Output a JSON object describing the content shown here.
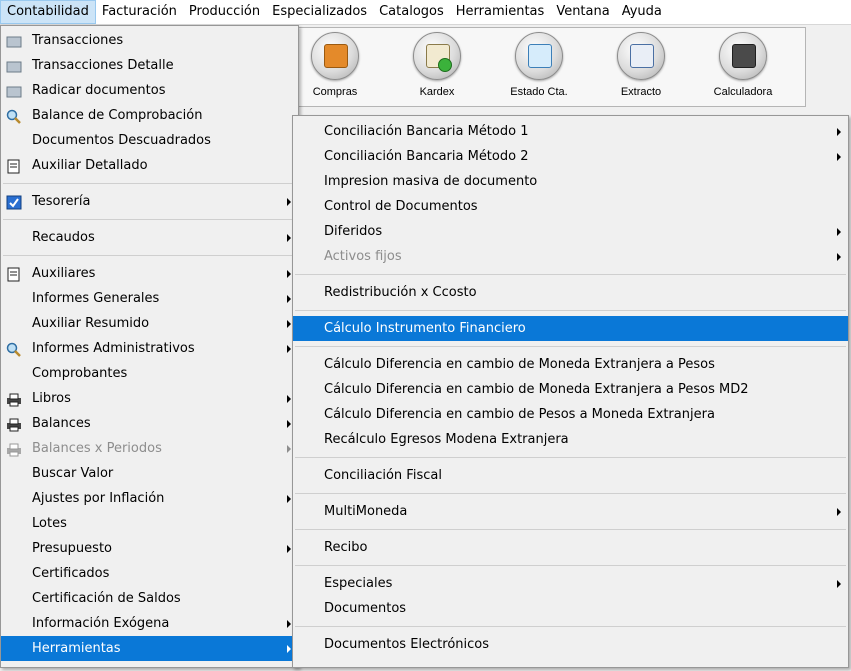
{
  "menubar": {
    "items": [
      "Contabilidad",
      "Facturación",
      "Producción",
      "Especializados",
      "Catalogos",
      "Herramientas",
      "Ventana",
      "Ayuda"
    ]
  },
  "toolbar": {
    "buttons": [
      "Compras",
      "Kardex",
      "Estado Cta.",
      "Extracto",
      "Calculadora"
    ]
  },
  "left_menu": {
    "items": {
      "transacciones": "Transacciones",
      "transacciones_detalle": "Transacciones Detalle",
      "radicar_documentos": "Radicar documentos",
      "balance_comprobacion": "Balance de Comprobación",
      "documentos_descuadrados": "Documentos Descuadrados",
      "auxiliar_detallado": "Auxiliar Detallado",
      "tesoreria": "Tesorería",
      "recaudos": "Recaudos",
      "auxiliares": "Auxiliares",
      "informes_generales": "Informes Generales",
      "auxiliar_resumido": "Auxiliar Resumido",
      "informes_administrativos": "Informes Administrativos",
      "comprobantes": "Comprobantes",
      "libros": "Libros",
      "balances": "Balances",
      "balances_periodos": "Balances x Periodos",
      "buscar_valor": "Buscar Valor",
      "ajustes_inflacion": "Ajustes por Inflación",
      "lotes": "Lotes",
      "presupuesto": "Presupuesto",
      "certificados": "Certificados",
      "certificacion_saldos": "Certificación de Saldos",
      "informacion_exogena": "Información Exógena",
      "herramientas": "Herramientas"
    }
  },
  "right_menu": {
    "items": {
      "conciliacion_1": "Conciliación Bancaria  Método 1",
      "conciliacion_2": "Conciliación Bancaria Método 2",
      "impresion_masiva": "Impresion masiva de documento",
      "control_documentos": "Control de Documentos",
      "diferidos": "Diferidos",
      "activos_fijos": "Activos fijos",
      "redistribucion": "Redistribución x Ccosto",
      "calculo_instrumento": "Cálculo Instrumento Financiero",
      "dif_cambio_1": "Cálculo Diferencia en cambio de Moneda Extranjera a Pesos",
      "dif_cambio_2": "Cálculo Diferencia en cambio de Moneda Extranjera a Pesos MD2",
      "dif_cambio_3": "Cálculo Diferencia en cambio de Pesos a Moneda Extranjera",
      "recalculo_egresos": "Recálculo Egresos Modena Extranjera",
      "conciliacion_fiscal": "Conciliación Fiscal",
      "multimoneda": "MultiMoneda",
      "recibo": "Recibo",
      "especiales": "Especiales",
      "documentos": "Documentos",
      "documentos_electronicos": "Documentos Electrónicos"
    }
  },
  "colors": {
    "selection": "#0a78d7",
    "menubar_active": "#cce4f7",
    "disabled_text": "#8d8d8d"
  }
}
